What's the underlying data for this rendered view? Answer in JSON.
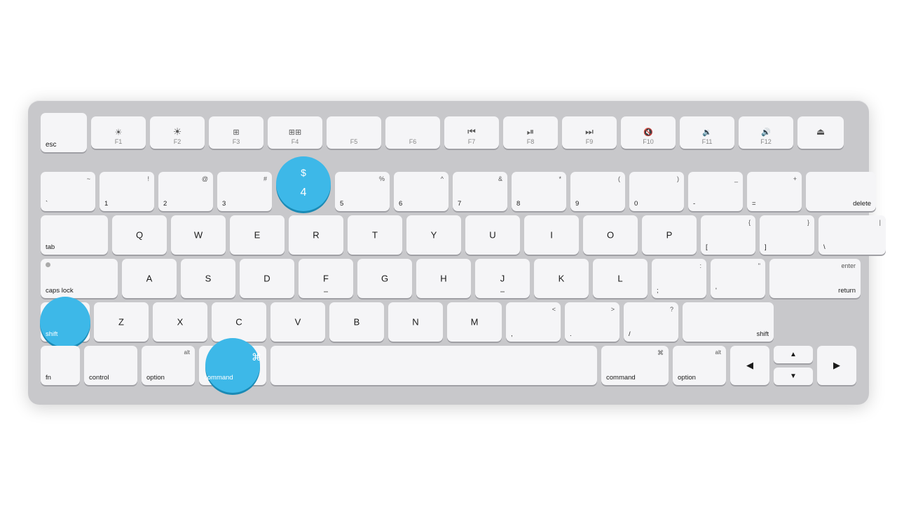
{
  "keyboard": {
    "background_color": "#c8c8cb",
    "rows": {
      "fn_row": [
        "esc",
        "F1",
        "F2",
        "F3",
        "F4",
        "F5",
        "F6",
        "F7",
        "F8",
        "F9",
        "F10",
        "F11",
        "F12",
        "eject"
      ],
      "number_row": [
        "~`",
        "!1",
        "@2",
        "#3",
        "$4",
        "%5",
        "^6",
        "&7",
        "*8",
        "(9",
        ")0",
        "-_",
        "=+",
        "delete"
      ],
      "qwerty_row": [
        "tab",
        "Q",
        "W",
        "E",
        "R",
        "T",
        "Y",
        "U",
        "I",
        "O",
        "P",
        "[{",
        "]}",
        "\\|"
      ],
      "home_row": [
        "caps lock",
        "A",
        "S",
        "D",
        "F",
        "G",
        "H",
        "J",
        "K",
        "L",
        ";:",
        "'\"",
        "return"
      ],
      "shift_row": [
        "shift",
        "Z",
        "X",
        "C",
        "V",
        "B",
        "N",
        "M",
        ",<",
        ".>",
        "/?",
        "shift"
      ],
      "bottom_row": [
        "fn",
        "control",
        "option",
        "command",
        "space",
        "command",
        "option",
        "◄",
        "▲▼"
      ]
    },
    "highlighted_keys": [
      "$4",
      "shift_left",
      "command_left"
    ],
    "accent_color": "#3db8e8"
  }
}
